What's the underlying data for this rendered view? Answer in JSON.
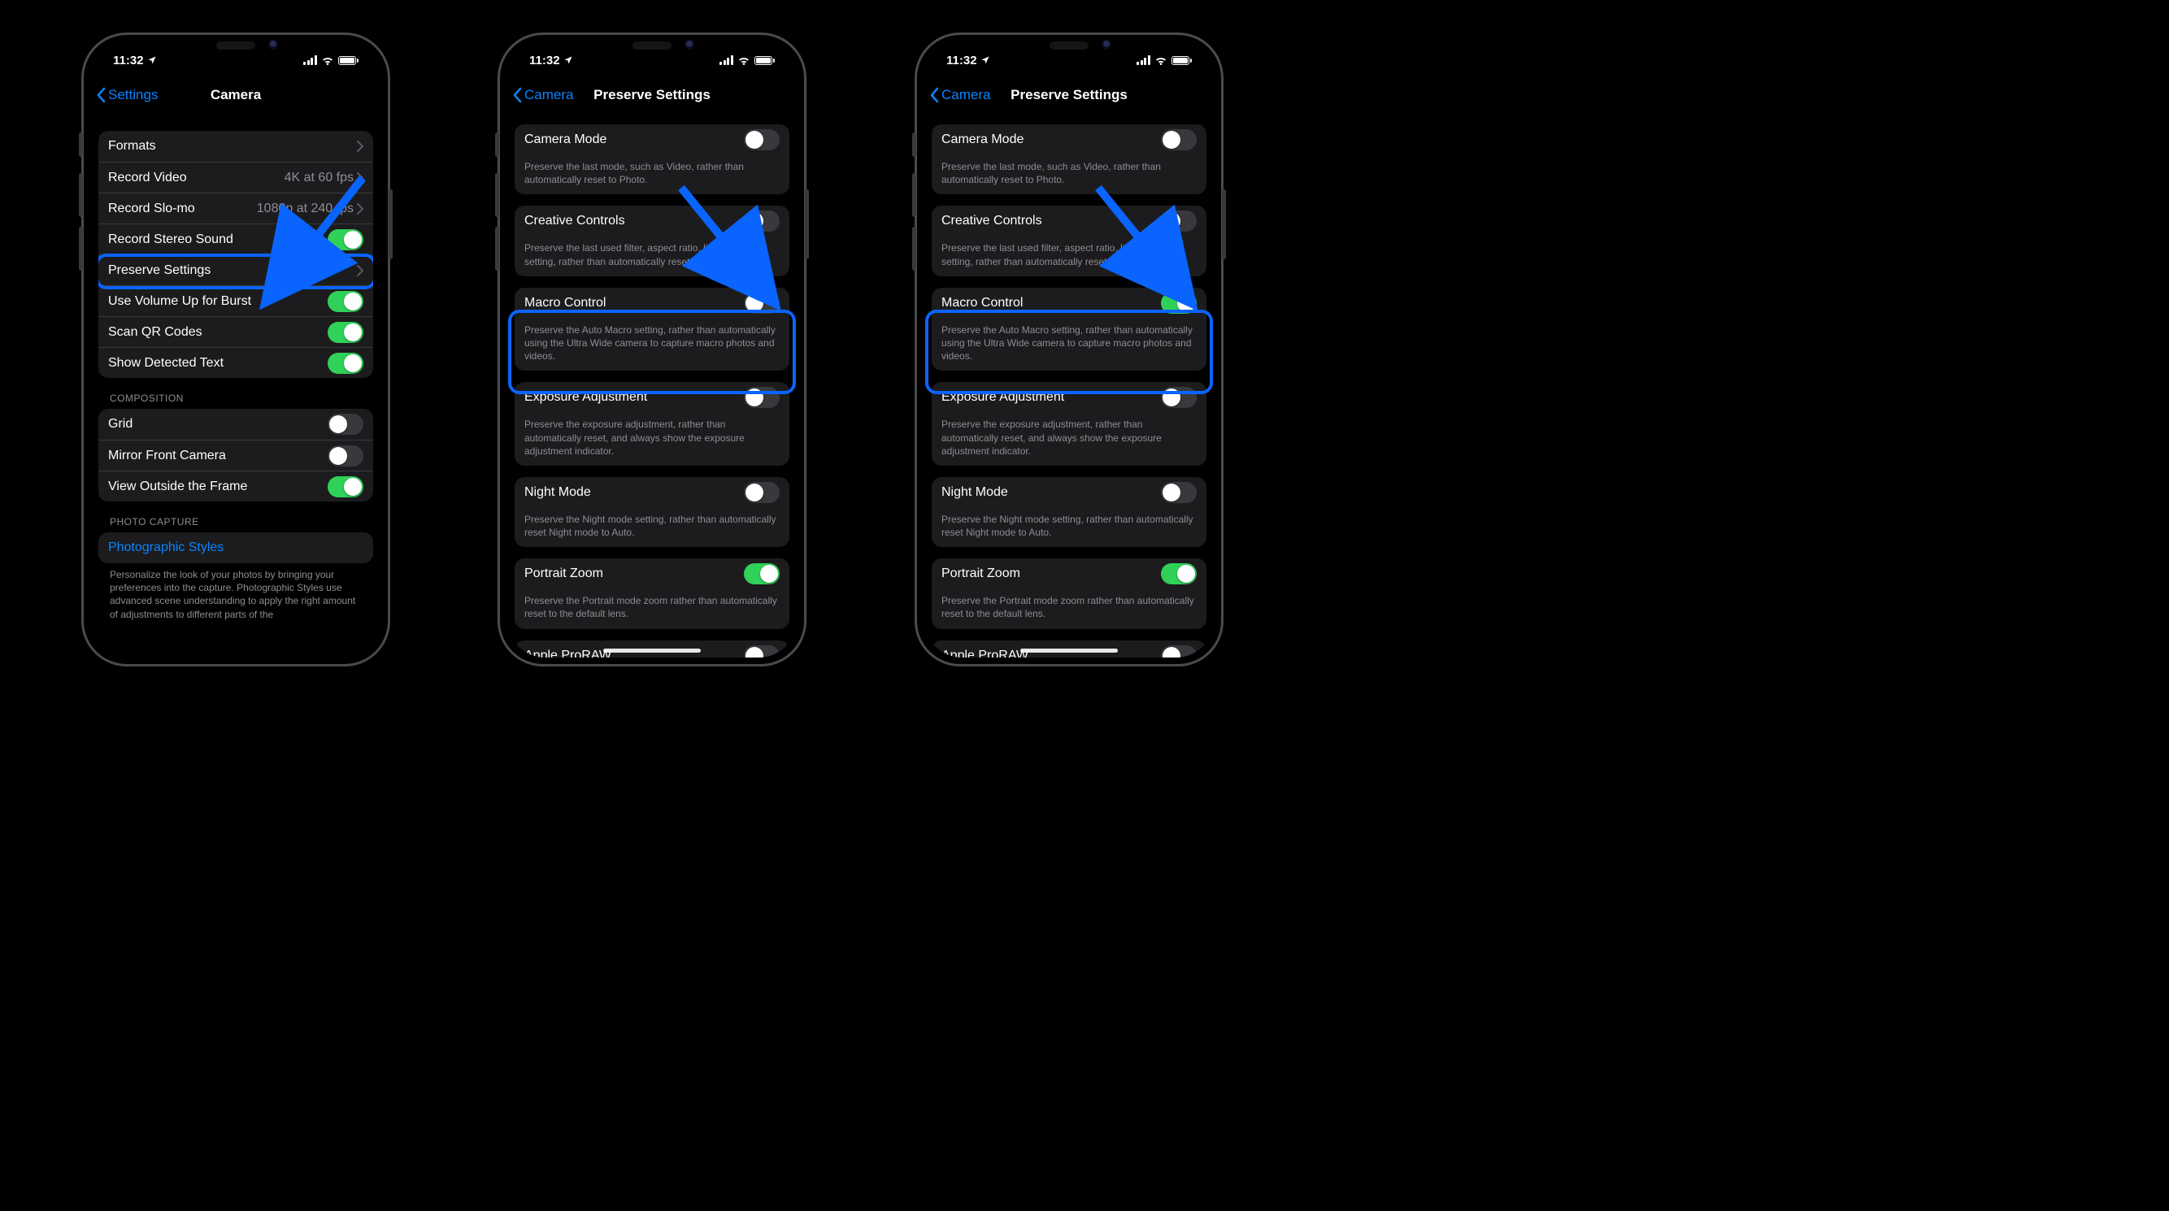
{
  "status": {
    "time": "11:32"
  },
  "phone1": {
    "back": "Settings",
    "title": "Camera",
    "rows": {
      "formats": "Formats",
      "record_video": "Record Video",
      "record_video_val": "4K at 60 fps",
      "record_slomo": "Record Slo-mo",
      "record_slomo_val": "1080p at 240 fps",
      "stereo": "Record Stereo Sound",
      "preserve": "Preserve Settings",
      "volume_burst": "Use Volume Up for Burst",
      "qr": "Scan QR Codes",
      "detected_text": "Show Detected Text"
    },
    "composition_header": "COMPOSITION",
    "composition": {
      "grid": "Grid",
      "mirror": "Mirror Front Camera",
      "outside": "View Outside the Frame"
    },
    "photo_capture_header": "PHOTO CAPTURE",
    "photographic_styles": "Photographic Styles",
    "photographic_desc": "Personalize the look of your photos by bringing your preferences into the capture. Photographic Styles use advanced scene understanding to apply the right amount of adjustments to different parts of the"
  },
  "preserve": {
    "back": "Camera",
    "title": "Preserve Settings",
    "camera_mode": "Camera Mode",
    "camera_mode_desc": "Preserve the last mode, such as Video, rather than automatically reset to Photo.",
    "creative": "Creative Controls",
    "creative_desc": "Preserve the last used filter, aspect ratio, light, or depth setting, rather than automatically reset.",
    "macro": "Macro Control",
    "macro_desc": "Preserve the Auto Macro setting, rather than automatically using the Ultra Wide camera to capture macro photos and videos.",
    "exposure": "Exposure Adjustment",
    "exposure_desc": "Preserve the exposure adjustment, rather than automatically reset, and always show the exposure adjustment indicator.",
    "night": "Night Mode",
    "night_desc": "Preserve the Night mode setting, rather than automatically reset Night mode to Auto.",
    "portrait": "Portrait Zoom",
    "portrait_desc": "Preserve the Portrait mode zoom rather than automatically reset to the default lens.",
    "proraw": "Apple ProRAW"
  },
  "phone2": {
    "macro_on": false
  },
  "phone3": {
    "macro_on": true
  }
}
